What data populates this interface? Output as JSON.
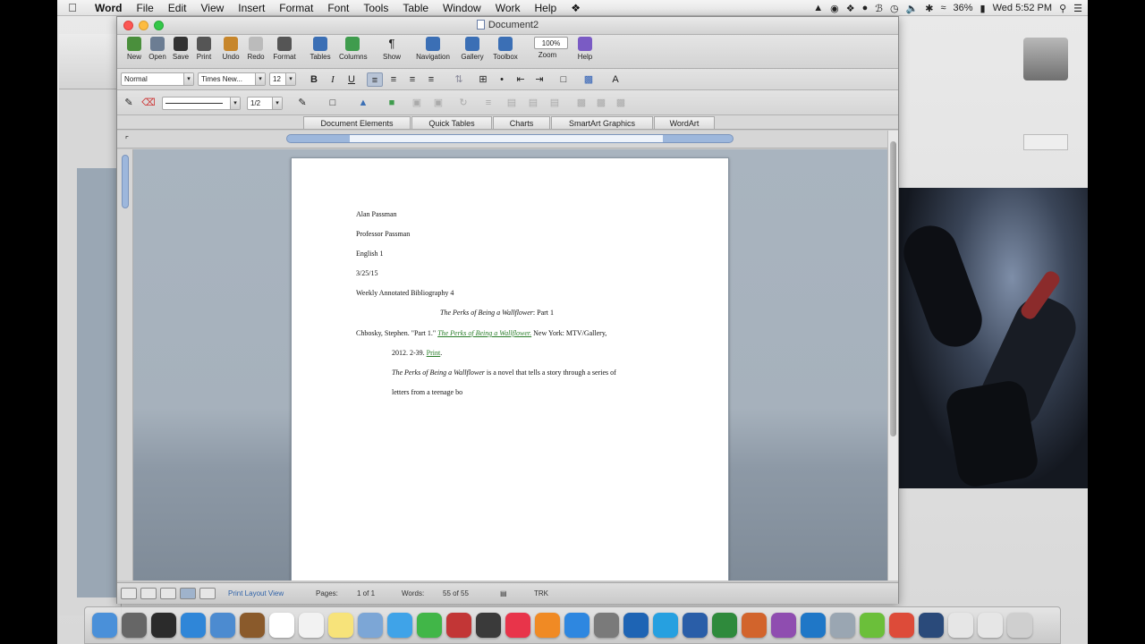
{
  "menubar": {
    "app": "Word",
    "items": [
      "File",
      "Edit",
      "View",
      "Insert",
      "Format",
      "Font",
      "Tools",
      "Table",
      "Window",
      "Work",
      "Help"
    ],
    "battery": "36%",
    "clock": "Wed 5:52 PM"
  },
  "window": {
    "title": "Document2"
  },
  "standard_toolbar": [
    {
      "label": "New",
      "icon": "new-document-icon",
      "color": "#4a8f3c"
    },
    {
      "label": "Open",
      "icon": "open-folder-icon",
      "color": "#6c7d93"
    },
    {
      "label": "Save",
      "icon": "save-disk-icon",
      "color": "#333333"
    },
    {
      "label": "Print",
      "icon": "printer-icon",
      "color": "#555555"
    },
    {
      "label": "Undo",
      "icon": "undo-icon",
      "color": "#c7862b"
    },
    {
      "label": "Redo",
      "icon": "redo-icon",
      "color": "#bbbbbb"
    },
    {
      "label": "Format",
      "icon": "format-painter-icon",
      "color": "#555555"
    },
    {
      "label": "Tables",
      "icon": "table-icon",
      "color": "#3b6fb5"
    },
    {
      "label": "Columns",
      "icon": "columns-icon",
      "color": "#3f9c4d"
    },
    {
      "label": "Show",
      "icon": "pilcrow-icon",
      "color": "#222222"
    },
    {
      "label": "Navigation",
      "icon": "navigation-pane-icon",
      "color": "#3b6fb5"
    },
    {
      "label": "Gallery",
      "icon": "gallery-icon",
      "color": "#3b6fb5"
    },
    {
      "label": "Toolbox",
      "icon": "toolbox-icon",
      "color": "#3b6fb5"
    },
    {
      "label": "Zoom",
      "icon": "zoom-icon",
      "color": "#ffffff"
    },
    {
      "label": "Help",
      "icon": "help-icon",
      "color": "#7a5bc4"
    }
  ],
  "zoom_value": "100%",
  "formatting": {
    "style": "Normal",
    "font": "Times New...",
    "size": "12",
    "bold": "B",
    "italic": "I",
    "underline": "U",
    "font_color_glyph": "A",
    "pilcrow": "¶"
  },
  "drawing": {
    "line_weight": "1/2"
  },
  "gallery_tabs": [
    "Document Elements",
    "Quick Tables",
    "Charts",
    "SmartArt Graphics",
    "WordArt"
  ],
  "document": {
    "lines": [
      "Alan Passman",
      "Professor Passman",
      "English 1",
      "3/25/15",
      "Weekly Annotated Bibliography 4"
    ],
    "title_italic": "The Perks of Being a Wallflower",
    "title_rest": ": Part 1",
    "citation_a": "Chbosky, Stephen. \"Part 1.\" ",
    "citation_title": "The Perks of Being a Wallflower.",
    "citation_b": " New York: MTV/Gallery,",
    "citation_c": "2012. 2-39. ",
    "citation_print": "Print",
    "citation_end": ".",
    "para_italic": "The Perks of Being a Wallflower",
    "para_rest": " is a novel that tells a story through a series of",
    "para_line2": "letters from a teenage bo"
  },
  "status": {
    "view_label": "Print Layout View",
    "pages_label": "Pages:",
    "pages_value": "1 of 1",
    "words_label": "Words:",
    "words_value": "55 of 55",
    "trk": "TRK"
  },
  "dock_apps": [
    {
      "name": "finder",
      "color": "#4a90d9"
    },
    {
      "name": "launchpad",
      "color": "#666666"
    },
    {
      "name": "mission-control",
      "color": "#2b2b2b"
    },
    {
      "name": "safari",
      "color": "#2f86d8"
    },
    {
      "name": "mail-stamp",
      "color": "#4c8bd0"
    },
    {
      "name": "notebook",
      "color": "#8a5a2b"
    },
    {
      "name": "calendar",
      "color": "#ffffff"
    },
    {
      "name": "contacts",
      "color": "#f2f2f2"
    },
    {
      "name": "notes",
      "color": "#f7e37a"
    },
    {
      "name": "preview",
      "color": "#7ca6d6"
    },
    {
      "name": "messages",
      "color": "#3fa3e8"
    },
    {
      "name": "facetime",
      "color": "#41b648"
    },
    {
      "name": "photo-booth",
      "color": "#c23636"
    },
    {
      "name": "itunes-store",
      "color": "#3a3a3a"
    },
    {
      "name": "itunes",
      "color": "#e8344a"
    },
    {
      "name": "ibooks",
      "color": "#f08a24"
    },
    {
      "name": "app-store",
      "color": "#2e87e0"
    },
    {
      "name": "system-preferences",
      "color": "#7a7a7a"
    },
    {
      "name": "filezilla",
      "color": "#1e64b4"
    },
    {
      "name": "skype",
      "color": "#26a0e0"
    },
    {
      "name": "word",
      "color": "#2a5ea8"
    },
    {
      "name": "excel",
      "color": "#2f8a3c"
    },
    {
      "name": "powerpoint",
      "color": "#d2642c"
    },
    {
      "name": "onenote",
      "color": "#8f4db0"
    },
    {
      "name": "outlook",
      "color": "#1f77c7"
    },
    {
      "name": "toolbox-app",
      "color": "#9aa6b2"
    },
    {
      "name": "spotify",
      "color": "#6bbf3a"
    },
    {
      "name": "chrome",
      "color": "#dd4b39"
    },
    {
      "name": "quicktime",
      "color": "#2a4a7a"
    },
    {
      "name": "downloads-stack",
      "color": "#e6e6e6"
    },
    {
      "name": "documents-stack",
      "color": "#e6e6e6"
    },
    {
      "name": "trash",
      "color": "#cfcfcf"
    }
  ]
}
